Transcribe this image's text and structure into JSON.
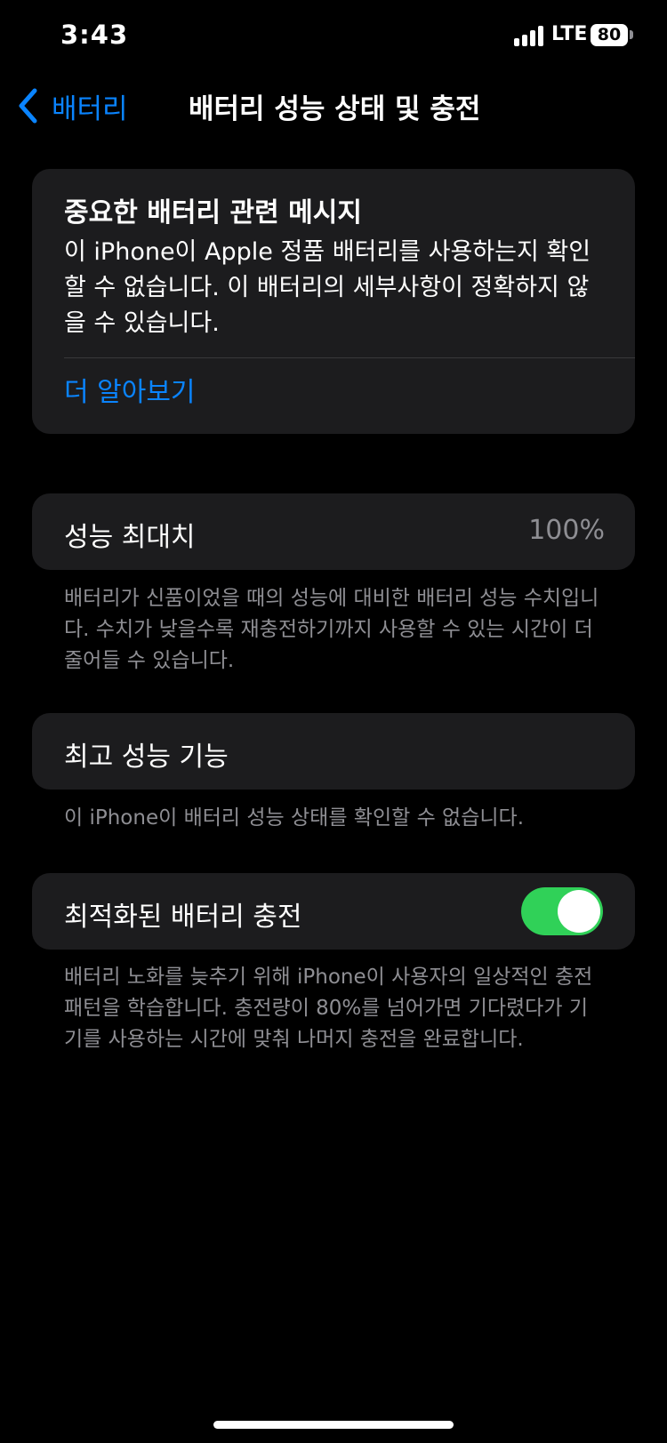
{
  "status_bar": {
    "time": "3:43",
    "network": "LTE",
    "battery": "80"
  },
  "nav": {
    "back_label": "배터리",
    "title": "배터리 성능 상태 및 충전"
  },
  "important_message": {
    "title": "중요한 배터리 관련 메시지",
    "body": "이 iPhone이 Apple 정품 배터리를 사용하는지 확인할 수 없습니다. 이 배터리의 세부사항이 정확하지 않을 수 있습니다.",
    "link": "더 알아보기"
  },
  "max_capacity": {
    "label": "성능 최대치",
    "value": "100%",
    "footnote": "배터리가 신품이었을 때의 성능에 대비한 배터리 성능 수치입니다. 수치가 낮을수록 재충전하기까지 사용할 수 있는 시간이 더 줄어들 수 있습니다."
  },
  "peak_performance": {
    "label": "최고 성능 기능",
    "footnote": "이 iPhone이 배터리 성능 상태를 확인할 수 없습니다."
  },
  "optimized_charging": {
    "label": "최적화된 배터리 충전",
    "enabled": true,
    "footnote": "배터리 노화를 늦추기 위해 iPhone이 사용자의 일상적인 충전 패턴을 학습합니다. 충전량이 80%를 넘어가면 기다렸다가 기기를 사용하는 시간에 맞춰 나머지 충전을 완료합니다."
  },
  "colors": {
    "accent": "#0a84ff",
    "toggle_on": "#30d158",
    "card_bg": "#1c1c1e",
    "secondary_text": "#8e8e93"
  },
  "icons": [
    "cellular-signal-icon",
    "battery-icon",
    "chevron-left-icon"
  ]
}
